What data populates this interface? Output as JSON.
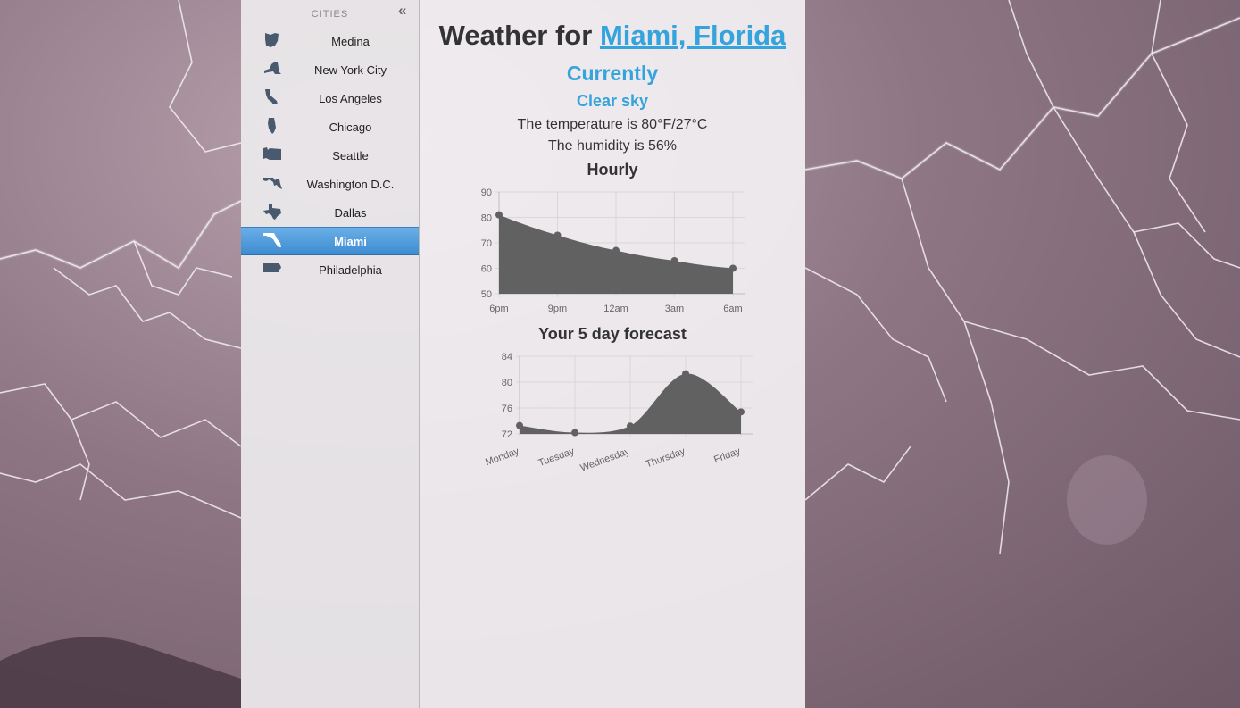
{
  "sidebar": {
    "header": "CITIES",
    "collapse_icon": "double-chevron-left-icon",
    "cities": [
      {
        "label": "Medina",
        "icon": "ohio-state-icon",
        "active": false
      },
      {
        "label": "New York City",
        "icon": "new-york-state-icon",
        "active": false
      },
      {
        "label": "Los Angeles",
        "icon": "california-state-icon",
        "active": false
      },
      {
        "label": "Chicago",
        "icon": "illinois-state-icon",
        "active": false
      },
      {
        "label": "Seattle",
        "icon": "washington-state-icon",
        "active": false
      },
      {
        "label": "Washington D.C.",
        "icon": "maryland-state-icon",
        "active": false
      },
      {
        "label": "Dallas",
        "icon": "texas-state-icon",
        "active": false
      },
      {
        "label": "Miami",
        "icon": "florida-state-icon",
        "active": true
      },
      {
        "label": "Philadelphia",
        "icon": "pennsylvania-state-icon",
        "active": false
      }
    ]
  },
  "main": {
    "title_prefix": "Weather for",
    "location": "Miami, Florida",
    "currently": "Currently",
    "summary": "Clear sky",
    "temperature": "The temperature is 80°F/27°C",
    "humidity": "The humidity is 56%",
    "hourly_title": "Hourly",
    "forecast_title": "Your 5 day forecast"
  },
  "colors": {
    "accent": "#35a3dc",
    "active_item": "#4a97d8",
    "chart_fill": "#616161"
  },
  "chart_data": [
    {
      "type": "area",
      "categories": [
        "6pm",
        "9pm",
        "12am",
        "3am",
        "6am"
      ],
      "series": [
        {
          "values": [
            81,
            73,
            67,
            63,
            60
          ]
        }
      ],
      "ylim": [
        50,
        90
      ],
      "yticks": [
        90,
        80,
        70,
        60,
        50
      ],
      "grid": true
    },
    {
      "type": "area",
      "categories": [
        "Monday",
        "Tuesday",
        "Wednesday",
        "Thursday",
        "Friday"
      ],
      "series": [
        {
          "values": [
            73.3,
            72.2,
            73.2,
            81.3,
            75.4
          ]
        }
      ],
      "ylim": [
        72,
        84
      ],
      "yticks": [
        84,
        80,
        76,
        72
      ],
      "grid": true
    }
  ]
}
